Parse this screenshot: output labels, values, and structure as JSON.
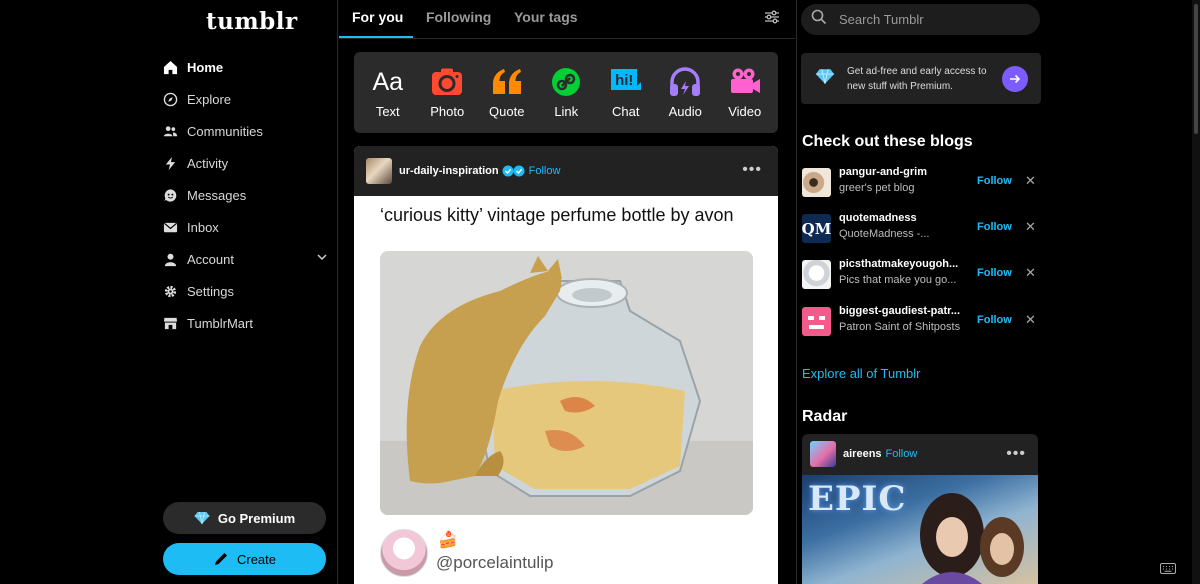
{
  "brand": {
    "logo": "tumblr"
  },
  "nav": [
    {
      "label": "Home",
      "icon": "home-icon",
      "active": true
    },
    {
      "label": "Explore",
      "icon": "compass-icon"
    },
    {
      "label": "Communities",
      "icon": "people-icon"
    },
    {
      "label": "Activity",
      "icon": "bolt-icon"
    },
    {
      "label": "Messages",
      "icon": "smiley-chat-icon"
    },
    {
      "label": "Inbox",
      "icon": "envelope-icon"
    },
    {
      "label": "Account",
      "icon": "person-icon"
    },
    {
      "label": "Settings",
      "icon": "gear-icon"
    },
    {
      "label": "TumblrMart",
      "icon": "store-icon"
    }
  ],
  "buttons": {
    "premium": "Go Premium",
    "create": "Create"
  },
  "tabs": [
    "For you",
    "Following",
    "Your tags"
  ],
  "composer": [
    "Text",
    "Photo",
    "Quote",
    "Link",
    "Chat",
    "Audio",
    "Video"
  ],
  "composer_icon_text": "Aa",
  "chat_icon_text": "hi!",
  "post": {
    "username": "ur-daily-inspiration",
    "follow": "Follow",
    "title": "‘curious kitty’ vintage perfume bottle by avon",
    "quote_handle": "@porcelaintulip"
  },
  "search": {
    "placeholder": "Search Tumblr"
  },
  "promo": {
    "text": "Get ad-free and early access to new stuff with Premium."
  },
  "blogs_section": {
    "title": "Check out these blogs",
    "follow": "Follow",
    "blogs": [
      {
        "name": "pangur-and-grim",
        "desc": "greer's pet blog"
      },
      {
        "name": "quotemadness",
        "desc": "QuoteMadness -...",
        "avatar_text": "QM"
      },
      {
        "name": "picsthatmakeyougoh...",
        "desc": "Pics that make you go..."
      },
      {
        "name": "biggest-gaudiest-patr...",
        "desc": "Patron Saint of Shitposts"
      }
    ],
    "explore": "Explore all of Tumblr"
  },
  "radar": {
    "title": "Radar",
    "username": "aireens",
    "follow": "Follow",
    "image_text": "EPIC"
  },
  "colors": {
    "accent": "#1dbcf5",
    "premium_purple": "#7c5cff",
    "card": "#2b2b2b"
  }
}
